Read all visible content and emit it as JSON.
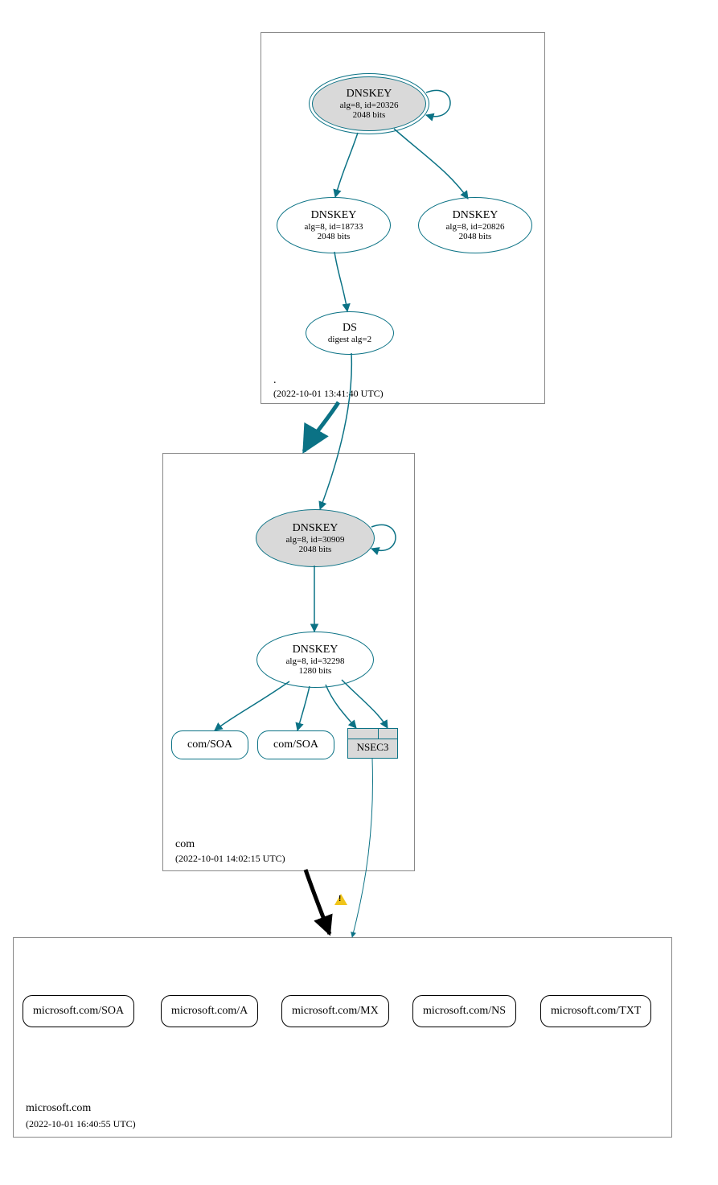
{
  "zones": {
    "root": {
      "name": ".",
      "timestamp": "(2022-10-01 13:41:40 UTC)"
    },
    "com": {
      "name": "com",
      "timestamp": "(2022-10-01 14:02:15 UTC)"
    },
    "ms": {
      "name": "microsoft.com",
      "timestamp": "(2022-10-01 16:40:55 UTC)"
    }
  },
  "nodes": {
    "root_ksk": {
      "title": "DNSKEY",
      "line1": "alg=8, id=20326",
      "line2": "2048 bits"
    },
    "root_zsk": {
      "title": "DNSKEY",
      "line1": "alg=8, id=18733",
      "line2": "2048 bits"
    },
    "root_zsk2": {
      "title": "DNSKEY",
      "line1": "alg=8, id=20826",
      "line2": "2048 bits"
    },
    "root_ds": {
      "title": "DS",
      "line1": "digest alg=2"
    },
    "com_ksk": {
      "title": "DNSKEY",
      "line1": "alg=8, id=30909",
      "line2": "2048 bits"
    },
    "com_zsk": {
      "title": "DNSKEY",
      "line1": "alg=8, id=32298",
      "line2": "1280 bits"
    },
    "com_soa1": {
      "label": "com/SOA"
    },
    "com_soa2": {
      "label": "com/SOA"
    },
    "nsec3": {
      "label": "NSEC3"
    },
    "ms_soa": {
      "label": "microsoft.com/SOA"
    },
    "ms_a": {
      "label": "microsoft.com/A"
    },
    "ms_mx": {
      "label": "microsoft.com/MX"
    },
    "ms_ns": {
      "label": "microsoft.com/NS"
    },
    "ms_txt": {
      "label": "microsoft.com/TXT"
    }
  }
}
